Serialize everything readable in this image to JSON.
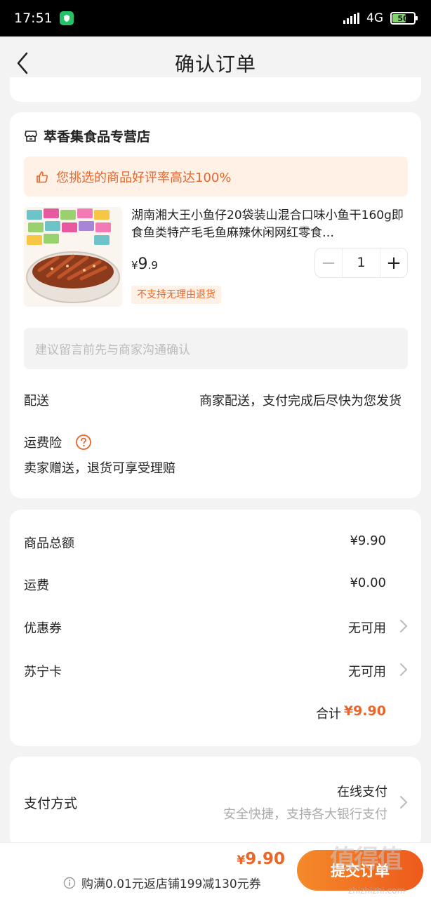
{
  "status_bar": {
    "time": "17:51",
    "network": "4G",
    "battery": "50"
  },
  "header": {
    "title": "确认订单"
  },
  "shop": {
    "name": "萃香集食品专营店",
    "praise_banner": "您挑选的商品好评率高达100%"
  },
  "product": {
    "title": "湖南湘大王小鱼仔20袋装山混合口味小鱼干160g即食鱼类特产毛毛鱼麻辣休闲网红零食…",
    "price_symbol": "¥",
    "price_int": "9",
    "price_dec": ".9",
    "quantity": "1",
    "minus_label": "−",
    "plus_label": "+",
    "badge": "不支持无理由退货"
  },
  "message": {
    "placeholder": "建议留言前先与商家沟通确认"
  },
  "delivery": {
    "label": "配送",
    "value": "商家配送，支付完成后尽快为您发货"
  },
  "insurance": {
    "label": "运费险",
    "desc": "卖家赠送，退货可享受理赔"
  },
  "summary": {
    "rows": [
      {
        "label": "商品总额",
        "value": "¥9.90"
      },
      {
        "label": "运费",
        "value": "¥0.00"
      },
      {
        "label": "优惠券",
        "value": "无可用"
      },
      {
        "label": "苏宁卡",
        "value": "无可用"
      }
    ],
    "total_label": "合计",
    "total_value": "¥9.90"
  },
  "payment": {
    "label": "支付方式",
    "value": "在线支付",
    "sub": "安全快捷，支持各大银行支付"
  },
  "bottom_bar": {
    "price_symbol": "¥",
    "price": "9.90",
    "coupon_text": "购满0.01元返店铺199减130元券",
    "submit_label": "提交订单"
  },
  "watermark": {
    "text": "值得值",
    "url": "zhizhizhi.com"
  },
  "colors": {
    "accent": "#e8662a",
    "background": "#f3f3f3"
  }
}
